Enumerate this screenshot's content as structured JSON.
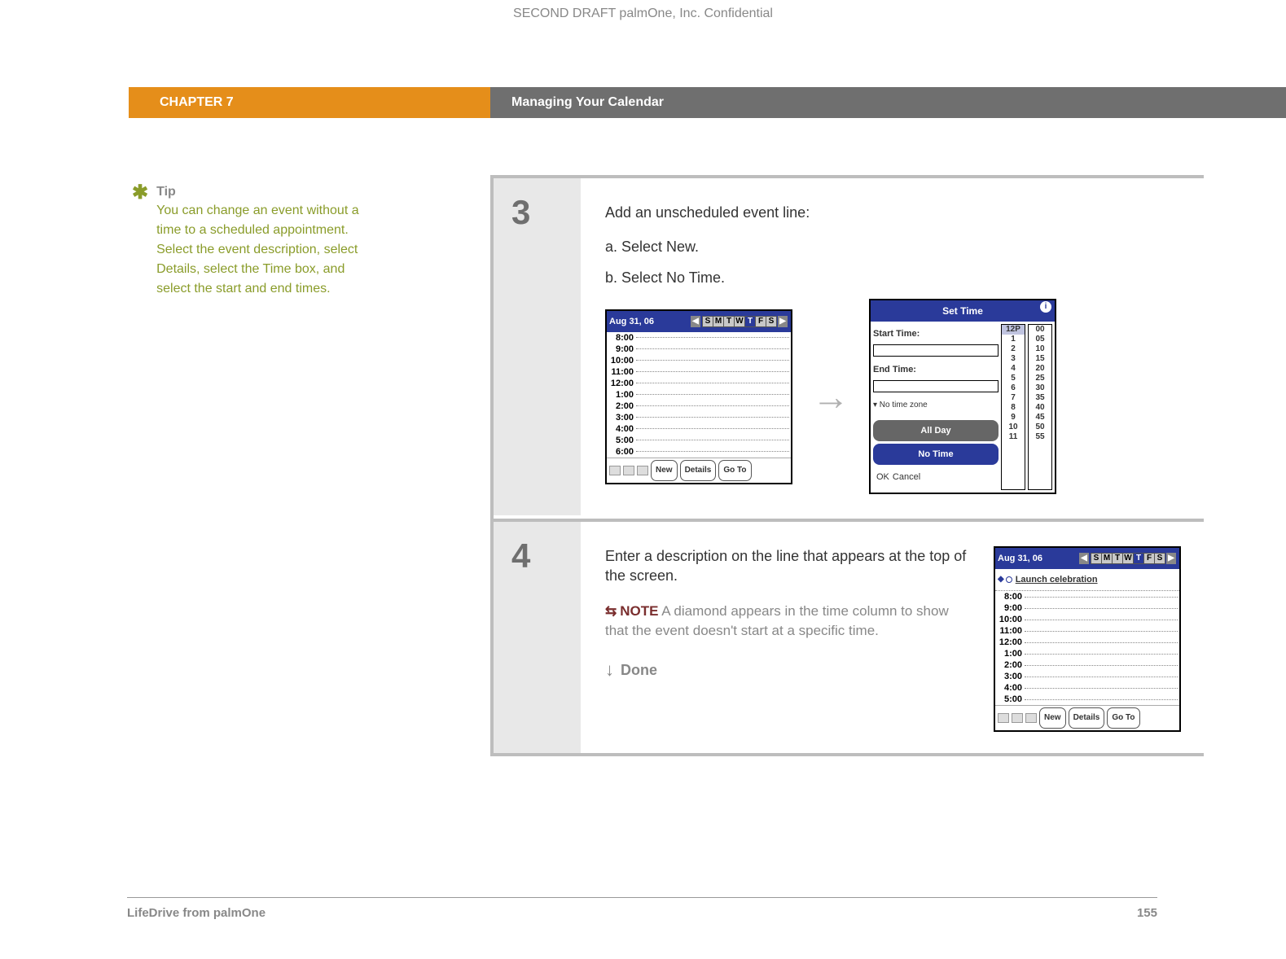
{
  "confidential": "SECOND DRAFT palmOne, Inc.  Confidential",
  "header": {
    "chapter": "CHAPTER 7",
    "title": "Managing Your Calendar"
  },
  "tip": {
    "heading": "Tip",
    "text": "You can change an event without a time to a scheduled appointment. Select the event description, select Details, select the Time box, and select the start and end times."
  },
  "step3": {
    "number": "3",
    "intro": "Add an unscheduled event line:",
    "sub_a": "a.  Select New.",
    "sub_b": "b.  Select No Time.",
    "dayview": {
      "date": "Aug 31, 06",
      "days": [
        "S",
        "M",
        "T",
        "W",
        "T",
        "F",
        "S"
      ],
      "selected_day_index": 4,
      "times": [
        "8:00",
        "9:00",
        "10:00",
        "11:00",
        "12:00",
        "1:00",
        "2:00",
        "3:00",
        "4:00",
        "5:00",
        "6:00"
      ],
      "buttons": {
        "new": "New",
        "details": "Details",
        "goto": "Go To"
      }
    },
    "settime": {
      "title": "Set Time",
      "start_label": "Start Time:",
      "end_label": "End Time:",
      "tz": "▾ No time zone",
      "allday": "All Day",
      "notime": "No Time",
      "ok": "OK",
      "cancel": "Cancel",
      "hours_header": "12P",
      "hours": [
        "1",
        "2",
        "3",
        "4",
        "5",
        "6",
        "7",
        "8",
        "9",
        "10",
        "11"
      ],
      "mins": [
        "00",
        "05",
        "10",
        "15",
        "20",
        "25",
        "30",
        "35",
        "40",
        "45",
        "50",
        "55"
      ]
    }
  },
  "step4": {
    "number": "4",
    "intro": "Enter a description on the line that appears at the top of the screen.",
    "note_label": "NOTE",
    "note_text": " A diamond appears in the time column to show that the event doesn't start at a specific time.",
    "done": "Done",
    "dayview": {
      "date": "Aug 31, 06",
      "days": [
        "S",
        "M",
        "T",
        "W",
        "T",
        "F",
        "S"
      ],
      "selected_day_index": 4,
      "event": "Launch celebration",
      "times": [
        "8:00",
        "9:00",
        "10:00",
        "11:00",
        "12:00",
        "1:00",
        "2:00",
        "3:00",
        "4:00",
        "5:00"
      ],
      "buttons": {
        "new": "New",
        "details": "Details",
        "goto": "Go To"
      }
    }
  },
  "footer": {
    "product": "LifeDrive from palmOne",
    "page": "155"
  }
}
